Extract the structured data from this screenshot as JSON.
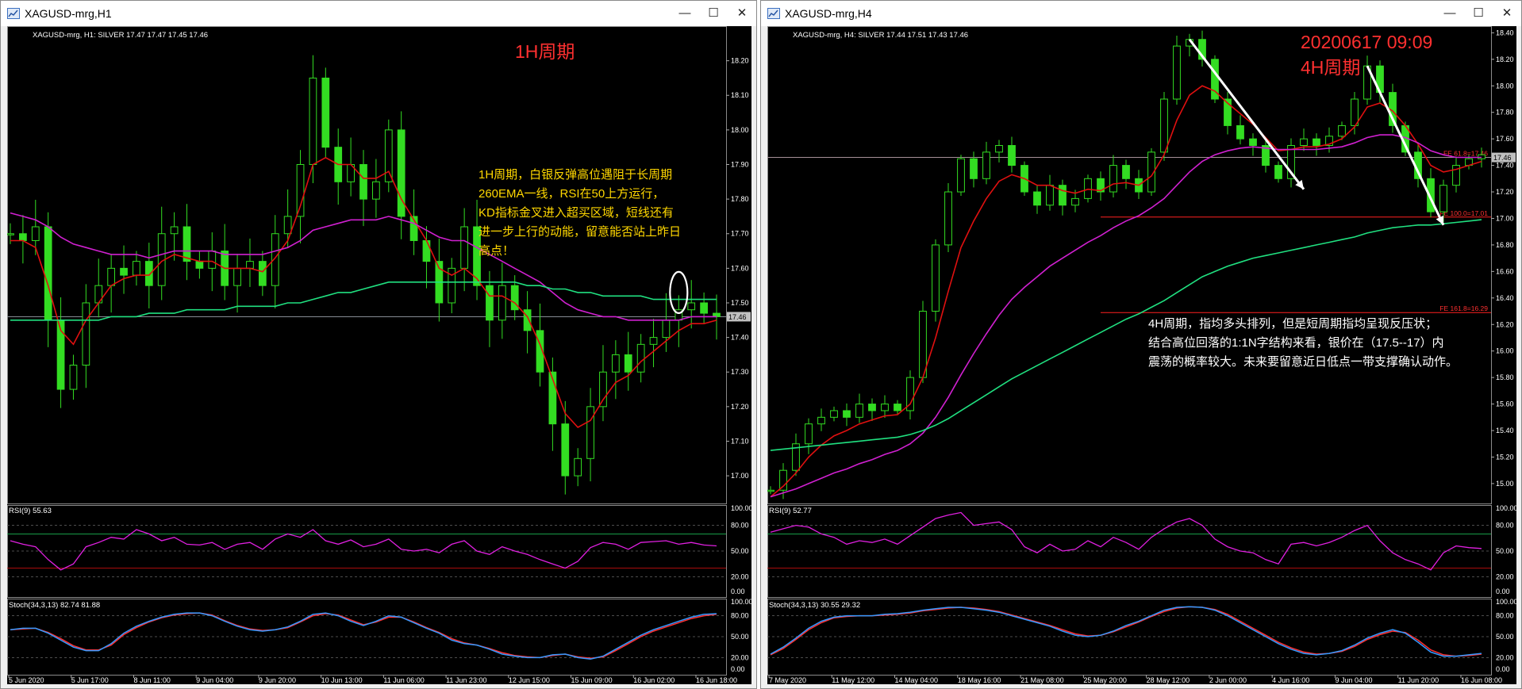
{
  "windows": [
    {
      "title": "XAGUSD-mrg,H1",
      "info": "XAGUSD-mrg, H1:  SILVER  17.47 17.47 17.45 17.46",
      "period_label": "1H周期",
      "date_label": "",
      "note_lines": [
        "1H周期，白银反弹高位遇阻于长周期",
        "260EMA一线，RSI在50上方运行，",
        "KD指标金叉进入超买区域，短线还有",
        "进一步上行的动能，留意能否站上昨日",
        "高点！"
      ],
      "current_price": "17.46",
      "rsi_label": "RSI(9) 55.63",
      "stoch_label": "Stoch(34,3,13) 82.74 81.88",
      "fib_labels": []
    },
    {
      "title": "XAGUSD-mrg,H4",
      "info": "XAGUSD-mrg, H4:  SILVER  17.44 17.51 17.43 17.46",
      "period_label": "4H周期",
      "date_label": "20200617 09:09",
      "note_lines": [
        "4H周期，指均多头排列，但是短周期指均呈现反压状；",
        "结合高位回落的1:1N字结构来看，银价在（17.5--17）内",
        "震荡的概率较大。未来要留意近日低点一带支撑确认动作。"
      ],
      "current_price": "17.46",
      "rsi_label": "RSI(9) 52.77",
      "stoch_label": "Stoch(34,3,13) 30.55 29.32",
      "fib_labels": [
        "FE 61.8=17.46",
        "FE 100.0=17.01",
        "FE 161.8=16.29"
      ]
    }
  ],
  "window_controls": {
    "minimize": "—",
    "maximize": "☐",
    "close": "✕"
  },
  "colors": {
    "background": "#000000",
    "candles": "#33dd22",
    "ema_fast": "#e01010",
    "ema_mid": "#d020d0",
    "ema_long": "#20e080",
    "rsi_line": "#e020e0",
    "stoch_main": "#3399ff",
    "stoch_signal": "#ff3030",
    "annotation_red": "#ff3030",
    "annotation_yellow": "#ffd700"
  },
  "chart_data": [
    {
      "type": "line",
      "title": "XAGUSD-mrg, H1",
      "ylim": [
        16.92,
        18.3
      ],
      "price_ticks": [
        "18.20",
        "18.10",
        "18.00",
        "17.90",
        "17.80",
        "17.70",
        "17.60",
        "17.50",
        "17.40",
        "17.30",
        "17.20",
        "17.10",
        "17.00"
      ],
      "time_labels": [
        "5 Jun 2020",
        "5 Jun 17:00",
        "8 Jun 11:00",
        "9 Jun 04:00",
        "9 Jun 20:00",
        "10 Jun 13:00",
        "11 Jun 06:00",
        "11 Jun 23:00",
        "12 Jun 15:00",
        "15 Jun 09:00",
        "16 Jun 02:00",
        "16 Jun 18:00"
      ],
      "series": [
        {
          "name": "",
          "role": "price",
          "values": [
            17.7,
            17.68,
            17.72,
            17.45,
            17.25,
            17.32,
            17.5,
            17.55,
            17.6,
            17.58,
            17.62,
            17.55,
            17.7,
            17.72,
            17.62,
            17.6,
            17.65,
            17.55,
            17.6,
            17.62,
            17.55,
            17.7,
            17.75,
            17.9,
            18.15,
            17.95,
            17.85,
            17.9,
            17.8,
            17.85,
            18.0,
            17.75,
            17.68,
            17.62,
            17.5,
            17.6,
            17.72,
            17.55,
            17.45,
            17.55,
            17.48,
            17.42,
            17.3,
            17.15,
            17.0,
            17.05,
            17.2,
            17.3,
            17.35,
            17.3,
            17.38,
            17.4,
            17.45,
            17.48,
            17.5,
            17.47,
            17.46
          ]
        },
        {
          "name": "",
          "role": "ema_fast",
          "values": [
            17.68,
            17.68,
            17.66,
            17.55,
            17.42,
            17.38,
            17.45,
            17.5,
            17.55,
            17.57,
            17.58,
            17.58,
            17.62,
            17.64,
            17.63,
            17.62,
            17.62,
            17.6,
            17.6,
            17.6,
            17.59,
            17.63,
            17.68,
            17.78,
            17.9,
            17.92,
            17.9,
            17.9,
            17.86,
            17.86,
            17.88,
            17.8,
            17.74,
            17.68,
            17.6,
            17.58,
            17.6,
            17.57,
            17.52,
            17.52,
            17.5,
            17.46,
            17.38,
            17.28,
            17.18,
            17.14,
            17.16,
            17.22,
            17.27,
            17.29,
            17.33,
            17.36,
            17.39,
            17.42,
            17.44,
            17.44,
            17.45
          ]
        },
        {
          "name": "",
          "role": "ema_mid",
          "values": [
            17.76,
            17.75,
            17.74,
            17.72,
            17.69,
            17.67,
            17.66,
            17.65,
            17.64,
            17.64,
            17.64,
            17.63,
            17.64,
            17.65,
            17.65,
            17.65,
            17.65,
            17.64,
            17.64,
            17.64,
            17.64,
            17.65,
            17.66,
            17.68,
            17.71,
            17.72,
            17.73,
            17.74,
            17.74,
            17.74,
            17.75,
            17.74,
            17.73,
            17.71,
            17.69,
            17.68,
            17.68,
            17.66,
            17.64,
            17.62,
            17.6,
            17.58,
            17.56,
            17.53,
            17.5,
            17.48,
            17.47,
            17.46,
            17.46,
            17.45,
            17.45,
            17.45,
            17.45,
            17.45,
            17.46,
            17.46,
            17.46
          ]
        },
        {
          "name": "",
          "role": "ema_long",
          "values": [
            17.45,
            17.45,
            17.45,
            17.45,
            17.45,
            17.45,
            17.45,
            17.45,
            17.46,
            17.46,
            17.46,
            17.47,
            17.47,
            17.47,
            17.48,
            17.48,
            17.48,
            17.48,
            17.49,
            17.49,
            17.49,
            17.49,
            17.5,
            17.5,
            17.51,
            17.52,
            17.53,
            17.53,
            17.54,
            17.55,
            17.56,
            17.56,
            17.56,
            17.56,
            17.56,
            17.56,
            17.56,
            17.56,
            17.56,
            17.56,
            17.56,
            17.55,
            17.55,
            17.54,
            17.54,
            17.53,
            17.53,
            17.52,
            17.52,
            17.52,
            17.52,
            17.51,
            17.51,
            17.51,
            17.51,
            17.51,
            17.51
          ]
        }
      ],
      "rsi": {
        "ylim": [
          0,
          100
        ],
        "levels": [
          80,
          70,
          50,
          30,
          20
        ],
        "values": [
          62,
          58,
          55,
          40,
          28,
          35,
          55,
          60,
          66,
          64,
          75,
          70,
          62,
          66,
          58,
          57,
          60,
          52,
          58,
          60,
          52,
          64,
          70,
          66,
          75,
          62,
          58,
          63,
          55,
          58,
          64,
          52,
          50,
          52,
          48,
          58,
          62,
          50,
          46,
          55,
          50,
          46,
          40,
          35,
          30,
          38,
          54,
          60,
          58,
          52,
          60,
          61,
          62,
          58,
          60,
          57,
          56
        ]
      },
      "stoch": {
        "ylim": [
          0,
          100
        ],
        "levels": [
          80,
          50,
          20
        ],
        "main": [
          60,
          62,
          62,
          55,
          45,
          35,
          30,
          30,
          40,
          55,
          65,
          72,
          78,
          82,
          84,
          84,
          80,
          72,
          65,
          60,
          58,
          60,
          64,
          72,
          82,
          84,
          80,
          72,
          66,
          72,
          80,
          78,
          70,
          62,
          55,
          45,
          40,
          38,
          32,
          25,
          22,
          20,
          20,
          24,
          25,
          20,
          18,
          22,
          32,
          42,
          52,
          60,
          66,
          72,
          78,
          82,
          83
        ],
        "signal": [
          60,
          61,
          62,
          56,
          47,
          37,
          31,
          31,
          38,
          53,
          63,
          71,
          77,
          81,
          83,
          84,
          81,
          73,
          66,
          61,
          59,
          60,
          63,
          71,
          80,
          83,
          81,
          74,
          67,
          71,
          78,
          78,
          71,
          63,
          56,
          47,
          41,
          38,
          33,
          27,
          23,
          21,
          20,
          23,
          25,
          21,
          19,
          21,
          30,
          40,
          50,
          58,
          64,
          70,
          76,
          80,
          82
        ]
      },
      "annotations": {
        "circle_at_index": 53,
        "circle_price": 17.53
      }
    },
    {
      "type": "line",
      "title": "XAGUSD-mrg, H4",
      "ylim": [
        14.85,
        18.45
      ],
      "price_ticks": [
        "18.40",
        "18.20",
        "18.00",
        "17.80",
        "17.60",
        "17.40",
        "17.20",
        "17.00",
        "16.80",
        "16.60",
        "16.40",
        "16.20",
        "16.00",
        "15.80",
        "15.60",
        "15.40",
        "15.20",
        "15.00"
      ],
      "time_labels": [
        "7 May 2020",
        "11 May 12:00",
        "14 May 04:00",
        "18 May 16:00",
        "21 May 08:00",
        "25 May 20:00",
        "28 May 12:00",
        "2 Jun 00:00",
        "4 Jun 16:00",
        "9 Jun 04:00",
        "11 Jun 20:00",
        "16 Jun 08:00"
      ],
      "series": [
        {
          "name": "",
          "role": "price",
          "values": [
            14.95,
            15.1,
            15.3,
            15.45,
            15.5,
            15.55,
            15.5,
            15.6,
            15.55,
            15.6,
            15.55,
            15.8,
            16.3,
            16.8,
            17.2,
            17.45,
            17.3,
            17.5,
            17.55,
            17.4,
            17.2,
            17.1,
            17.25,
            17.1,
            17.15,
            17.3,
            17.2,
            17.4,
            17.3,
            17.2,
            17.5,
            17.9,
            18.3,
            18.35,
            18.2,
            17.9,
            17.7,
            17.6,
            17.55,
            17.4,
            17.3,
            17.55,
            17.6,
            17.55,
            17.62,
            17.7,
            17.9,
            18.15,
            17.95,
            17.7,
            17.5,
            17.3,
            17.05,
            17.25,
            17.4,
            17.45,
            17.48
          ]
        },
        {
          "name": "",
          "role": "ema_fast",
          "values": [
            14.9,
            14.98,
            15.08,
            15.2,
            15.29,
            15.36,
            15.4,
            15.45,
            15.48,
            15.51,
            15.52,
            15.6,
            15.8,
            16.1,
            16.45,
            16.78,
            16.98,
            17.15,
            17.28,
            17.33,
            17.3,
            17.25,
            17.25,
            17.21,
            17.19,
            17.22,
            17.21,
            17.26,
            17.27,
            17.25,
            17.32,
            17.48,
            17.74,
            17.93,
            18.0,
            17.96,
            17.87,
            17.79,
            17.71,
            17.61,
            17.51,
            17.52,
            17.54,
            17.54,
            17.56,
            17.6,
            17.69,
            17.84,
            17.87,
            17.81,
            17.7,
            17.56,
            17.4,
            17.35,
            17.37,
            17.4,
            17.43
          ]
        },
        {
          "name": "",
          "role": "ema_mid",
          "values": [
            14.9,
            14.93,
            14.96,
            15.0,
            15.04,
            15.08,
            15.11,
            15.15,
            15.18,
            15.22,
            15.25,
            15.3,
            15.38,
            15.5,
            15.65,
            15.82,
            15.98,
            16.13,
            16.27,
            16.39,
            16.48,
            16.56,
            16.64,
            16.7,
            16.76,
            16.82,
            16.87,
            16.93,
            16.98,
            17.02,
            17.08,
            17.15,
            17.25,
            17.35,
            17.43,
            17.48,
            17.51,
            17.53,
            17.54,
            17.53,
            17.52,
            17.52,
            17.52,
            17.52,
            17.53,
            17.54,
            17.57,
            17.61,
            17.63,
            17.63,
            17.61,
            17.57,
            17.51,
            17.48,
            17.46,
            17.46,
            17.46
          ]
        },
        {
          "name": "",
          "role": "ema_long",
          "values": [
            15.25,
            15.26,
            15.27,
            15.28,
            15.29,
            15.3,
            15.31,
            15.32,
            15.33,
            15.34,
            15.35,
            15.37,
            15.4,
            15.44,
            15.49,
            15.55,
            15.61,
            15.67,
            15.73,
            15.79,
            15.84,
            15.89,
            15.94,
            15.99,
            16.04,
            16.09,
            16.14,
            16.19,
            16.24,
            16.28,
            16.33,
            16.38,
            16.44,
            16.5,
            16.56,
            16.6,
            16.64,
            16.67,
            16.7,
            16.72,
            16.74,
            16.76,
            16.78,
            16.8,
            16.82,
            16.84,
            16.86,
            16.89,
            16.91,
            16.93,
            16.94,
            16.95,
            16.95,
            16.96,
            16.97,
            16.98,
            16.99
          ]
        }
      ],
      "rsi": {
        "ylim": [
          0,
          100
        ],
        "levels": [
          80,
          70,
          50,
          30,
          20
        ],
        "values": [
          72,
          76,
          80,
          78,
          70,
          66,
          58,
          62,
          60,
          64,
          58,
          68,
          78,
          88,
          92,
          95,
          80,
          82,
          84,
          75,
          55,
          48,
          58,
          50,
          52,
          62,
          55,
          66,
          60,
          52,
          66,
          76,
          84,
          88,
          80,
          64,
          55,
          50,
          48,
          40,
          35,
          58,
          60,
          56,
          60,
          66,
          74,
          80,
          62,
          48,
          40,
          35,
          28,
          48,
          56,
          54,
          53
        ]
      },
      "stoch": {
        "ylim": [
          0,
          100
        ],
        "levels": [
          80,
          50,
          20
        ],
        "main": [
          25,
          35,
          48,
          62,
          72,
          78,
          80,
          80,
          80,
          82,
          83,
          85,
          88,
          90,
          92,
          92,
          90,
          88,
          85,
          80,
          75,
          70,
          65,
          58,
          52,
          50,
          52,
          58,
          66,
          72,
          80,
          88,
          92,
          93,
          92,
          88,
          80,
          70,
          60,
          50,
          40,
          32,
          26,
          24,
          26,
          30,
          38,
          48,
          55,
          60,
          55,
          42,
          28,
          22,
          22,
          24,
          26
        ],
        "signal": [
          24,
          33,
          46,
          60,
          70,
          77,
          79,
          80,
          80,
          81,
          82,
          84,
          87,
          89,
          91,
          92,
          91,
          89,
          86,
          81,
          76,
          71,
          66,
          60,
          54,
          51,
          52,
          57,
          64,
          71,
          79,
          86,
          91,
          93,
          92,
          89,
          82,
          72,
          62,
          52,
          42,
          34,
          28,
          25,
          26,
          29,
          36,
          46,
          53,
          58,
          56,
          45,
          31,
          24,
          22,
          23,
          25
        ]
      },
      "fib_levels": [
        17.46,
        17.01,
        16.29
      ],
      "arrows": [
        {
          "from_index": 33,
          "from_price": 18.35,
          "to_index": 42,
          "to_price": 17.22
        },
        {
          "from_index": 47,
          "from_price": 18.15,
          "to_index": 53,
          "to_price": 16.95
        }
      ]
    }
  ]
}
